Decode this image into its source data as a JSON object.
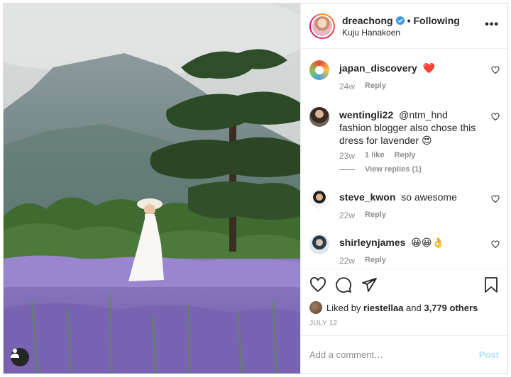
{
  "header": {
    "username": "dreachong",
    "follow_status": "Following",
    "location": "Kuju Hanakoen",
    "separator": "•"
  },
  "comments": [
    {
      "username": "japan_discovery",
      "text": "",
      "emoji": "❤️",
      "time": "24w",
      "likes": "",
      "reply": "Reply"
    },
    {
      "username": "wentingli22",
      "text": "@ntm_hnd fashion blogger also chose this dress for lavender",
      "emoji": "😍",
      "time": "23w",
      "likes": "1 like",
      "reply": "Reply",
      "view_replies": "View replies (1)"
    },
    {
      "username": "steve_kwon",
      "text": "so awesome",
      "emoji": "",
      "time": "22w",
      "likes": "",
      "reply": "Reply"
    },
    {
      "username": "shirleynjames",
      "text": "",
      "emoji": "😀😀👌",
      "time": "22w",
      "likes": "",
      "reply": "Reply"
    }
  ],
  "likes": {
    "prefix": "Liked by",
    "user": "riestellaa",
    "and": "and",
    "others": "3,779 others"
  },
  "date": "JULY 12",
  "add_comment": {
    "placeholder": "Add a comment…",
    "post_label": "Post"
  },
  "colors": {
    "verified_blue": "#3897f0",
    "heart_red": "#ed4956",
    "lavender": "#8d6fc4",
    "post_disabled": "#b2dffc"
  },
  "icons": [
    "verified-icon",
    "more-options-icon",
    "heart-icon",
    "comment-icon",
    "share-icon",
    "bookmark-icon",
    "user-tag-icon"
  ]
}
